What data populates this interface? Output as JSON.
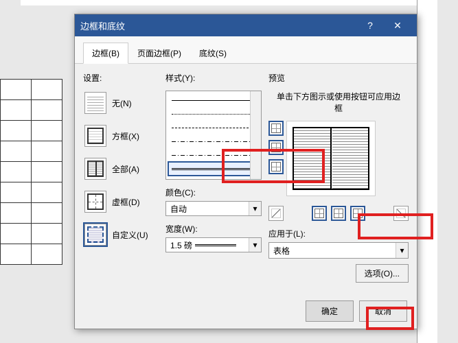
{
  "dialog": {
    "title": "边框和底纹",
    "help": "?",
    "close": "✕"
  },
  "tabs": {
    "borders": "边框(B)",
    "page_borders": "页面边框(P)",
    "shading": "底纹(S)"
  },
  "settings": {
    "label": "设置:",
    "none": "无(N)",
    "box": "方框(X)",
    "all": "全部(A)",
    "grid": "虚框(D)",
    "custom": "自定义(U)"
  },
  "style": {
    "label": "样式(Y):",
    "color_label": "颜色(C):",
    "color_value": "自动",
    "width_label": "宽度(W):",
    "width_value": "1.5 磅"
  },
  "preview": {
    "label": "预览",
    "hint": "单击下方图示或使用按钮可应用边框",
    "apply_to_label": "应用于(L):",
    "apply_to_value": "表格",
    "options": "选项(O)..."
  },
  "footer": {
    "ok": "确定",
    "cancel": "取消"
  }
}
